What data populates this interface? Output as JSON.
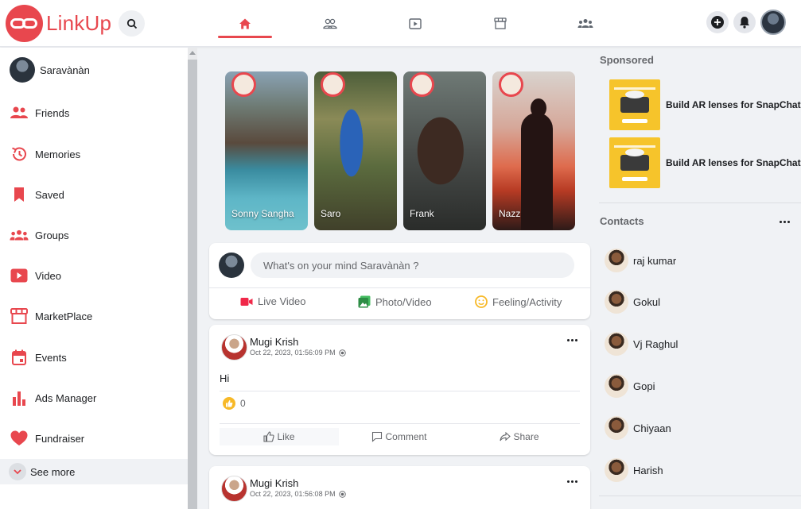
{
  "app": {
    "name": "LinkUp",
    "brand_color": "#e8474e"
  },
  "nav": {
    "tabs": [
      {
        "icon": "home-icon",
        "active": true
      },
      {
        "icon": "friends-icon",
        "active": false
      },
      {
        "icon": "video-icon",
        "active": false
      },
      {
        "icon": "marketplace-icon",
        "active": false
      },
      {
        "icon": "groups-icon",
        "active": false
      }
    ],
    "right_icons": [
      "plus-icon",
      "bell-icon",
      "avatar"
    ]
  },
  "sidebar": {
    "profile_name": "Saravànàn",
    "items": [
      {
        "label": "Friends",
        "icon": "friends-icon"
      },
      {
        "label": "Memories",
        "icon": "memories-icon"
      },
      {
        "label": "Saved",
        "icon": "bookmark-icon"
      },
      {
        "label": "Groups",
        "icon": "groups-icon"
      },
      {
        "label": "Video",
        "icon": "video-icon"
      },
      {
        "label": "MarketPlace",
        "icon": "marketplace-icon"
      },
      {
        "label": "Events",
        "icon": "calendar-icon"
      },
      {
        "label": "Ads Manager",
        "icon": "bar-chart-icon"
      },
      {
        "label": "Fundraiser",
        "icon": "heart-icon"
      }
    ],
    "see_more": "See more"
  },
  "stories": [
    {
      "name": "Sonny Sangha"
    },
    {
      "name": "Saro"
    },
    {
      "name": "Frank"
    },
    {
      "name": "Nazz"
    }
  ],
  "composer": {
    "placeholder": "What's on your mind Saravànàn ?",
    "actions": [
      {
        "label": "Live Video",
        "icon": "live-video-icon",
        "color": "#f02849"
      },
      {
        "label": "Photo/Video",
        "icon": "photo-icon",
        "color": "#45bd62"
      },
      {
        "label": "Feeling/Activity",
        "icon": "smile-icon",
        "color": "#f7b928"
      }
    ]
  },
  "posts": [
    {
      "author": "Mugi Krish",
      "date": "Oct 22, 2023, 01:56:09 PM",
      "text": "Hi",
      "likes": "0",
      "like_label": "Like",
      "comment_label": "Comment",
      "share_label": "Share"
    },
    {
      "author": "Mugi Krish",
      "date": "Oct 22, 2023, 01:56:08 PM"
    }
  ],
  "sponsored": {
    "title": "Sponsored",
    "ads": [
      {
        "text": "Build AR lenses for SnapChat"
      },
      {
        "text": "Build AR lenses for SnapChat"
      }
    ]
  },
  "contacts": {
    "title": "Contacts",
    "list": [
      "raj kumar",
      "Gokul",
      "Vj Raghul",
      "Gopi",
      "Chiyaan",
      "Harish"
    ]
  }
}
